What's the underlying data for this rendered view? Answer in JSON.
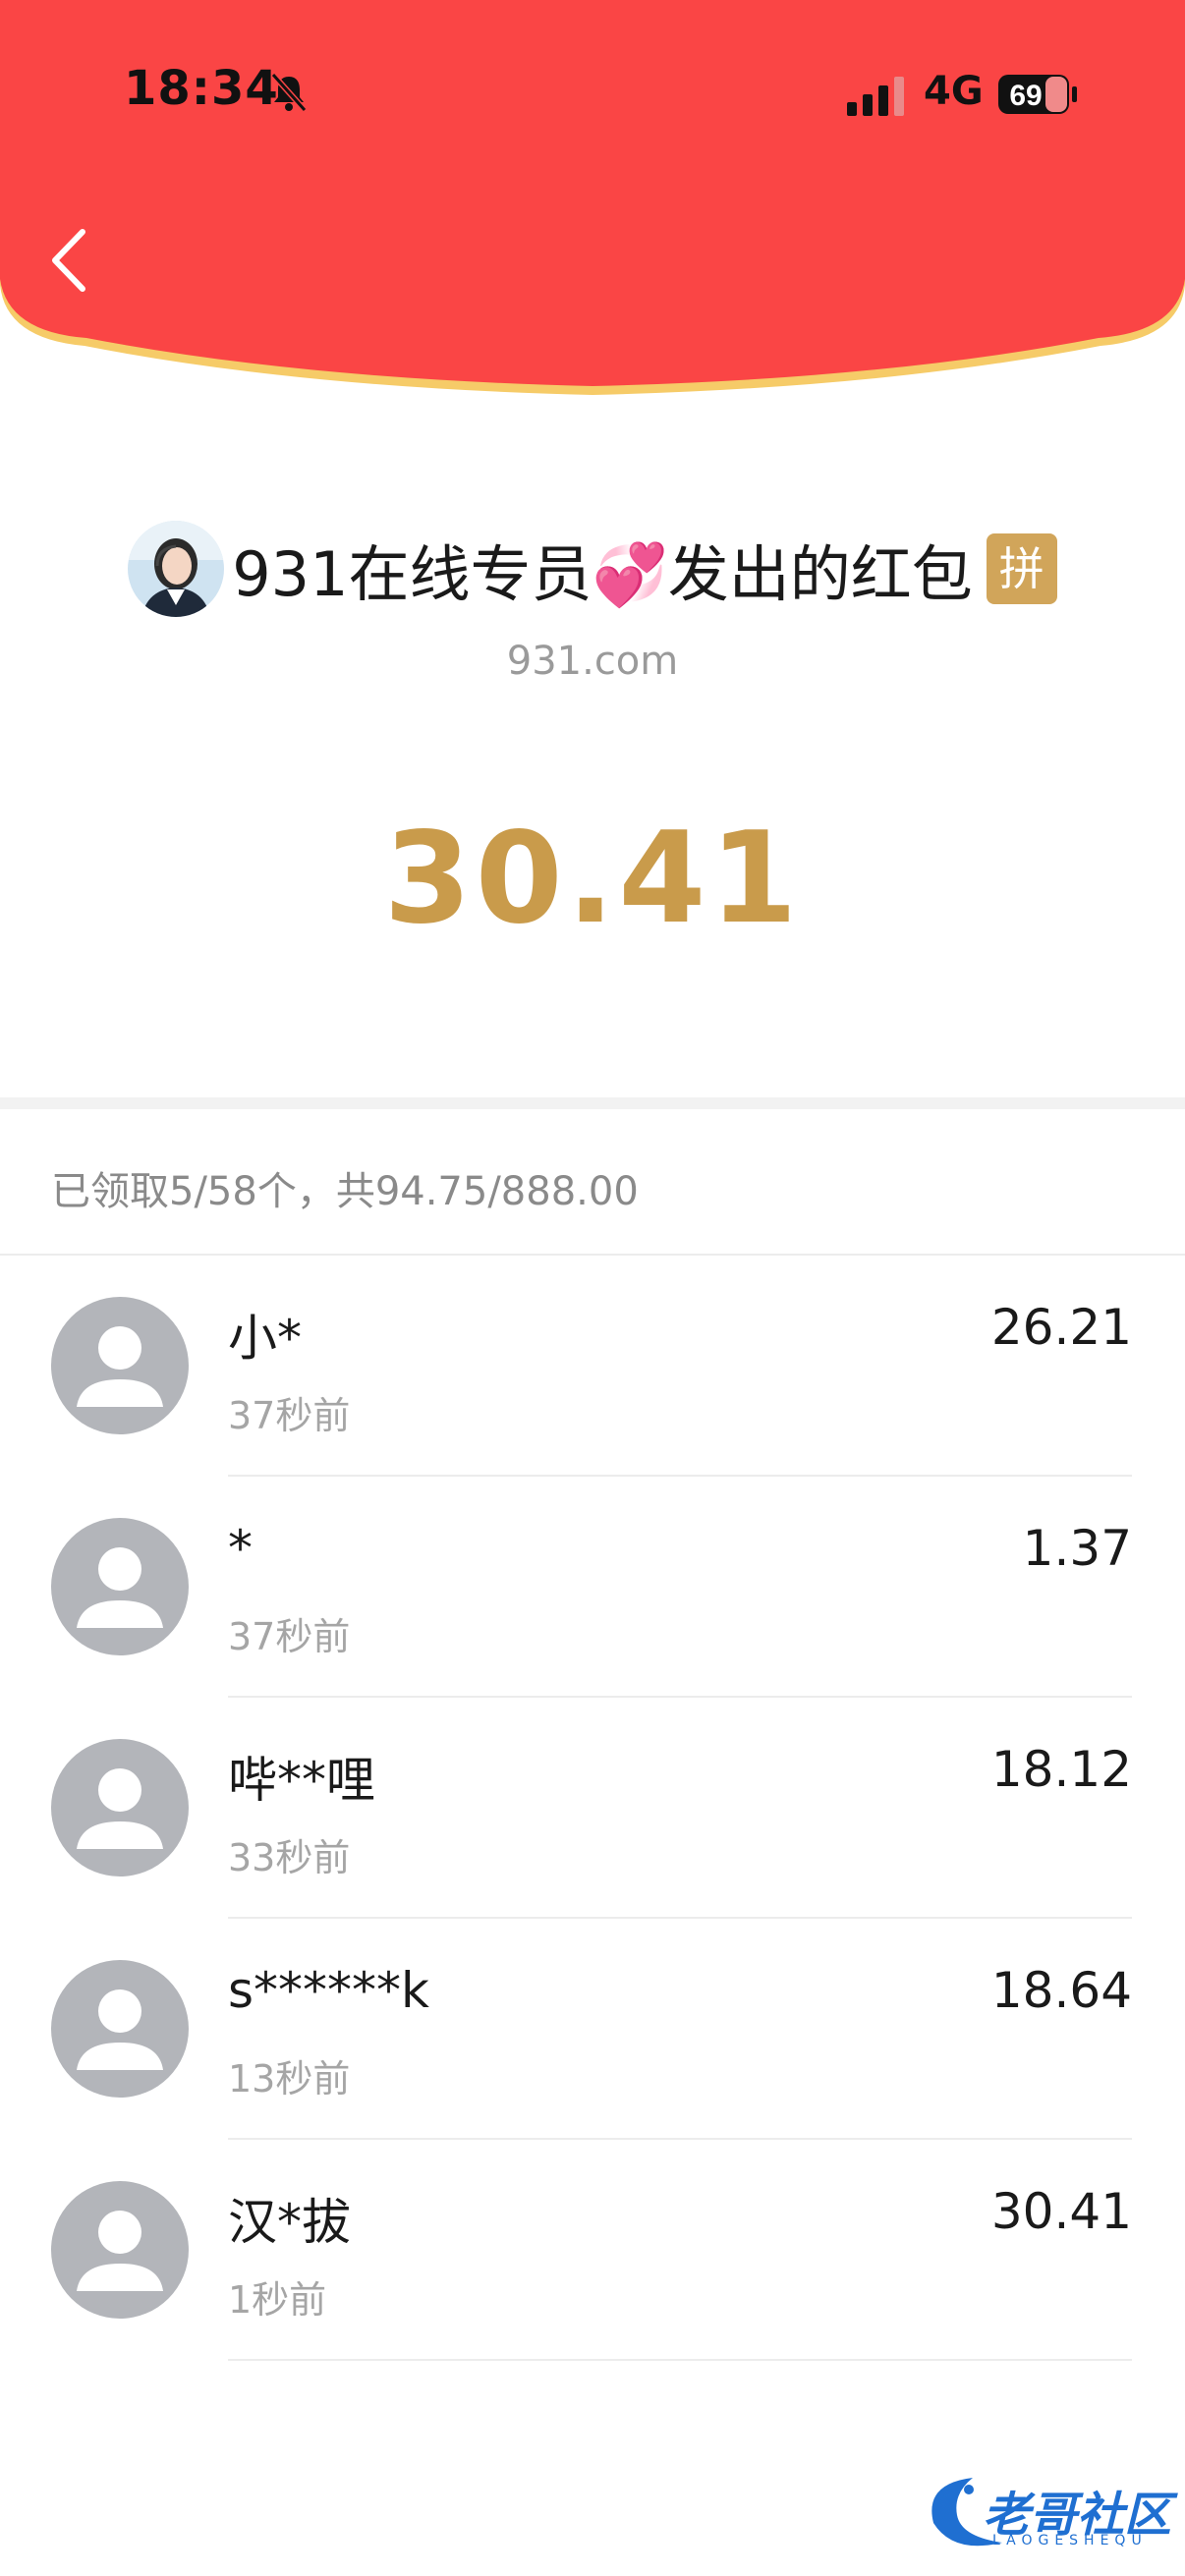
{
  "status": {
    "time": "18:34",
    "network": "4G",
    "battery": "69"
  },
  "colors": {
    "header_red": "#fa4545",
    "header_edge": "#f6cb68",
    "amount_gold": "#c99b4b",
    "badge_gold": "#d1a55a"
  },
  "sender": {
    "name": "931在线专员💞发出的红包",
    "badge": "拼",
    "domain": "931.com"
  },
  "amount": "30.41",
  "summary": "已领取5/58个，共94.75/888.00",
  "records": [
    {
      "name": "小*",
      "time": "37秒前",
      "amount": "26.21"
    },
    {
      "name": "*",
      "time": "37秒前",
      "amount": "1.37"
    },
    {
      "name": "哔**哩",
      "time": "33秒前",
      "amount": "18.12"
    },
    {
      "name": "s******k",
      "time": "13秒前",
      "amount": "18.64"
    },
    {
      "name": "汉*拔",
      "time": "1秒前",
      "amount": "30.41"
    }
  ],
  "watermark": {
    "text": "老哥社区",
    "sub": "LAOGESHEQU"
  }
}
